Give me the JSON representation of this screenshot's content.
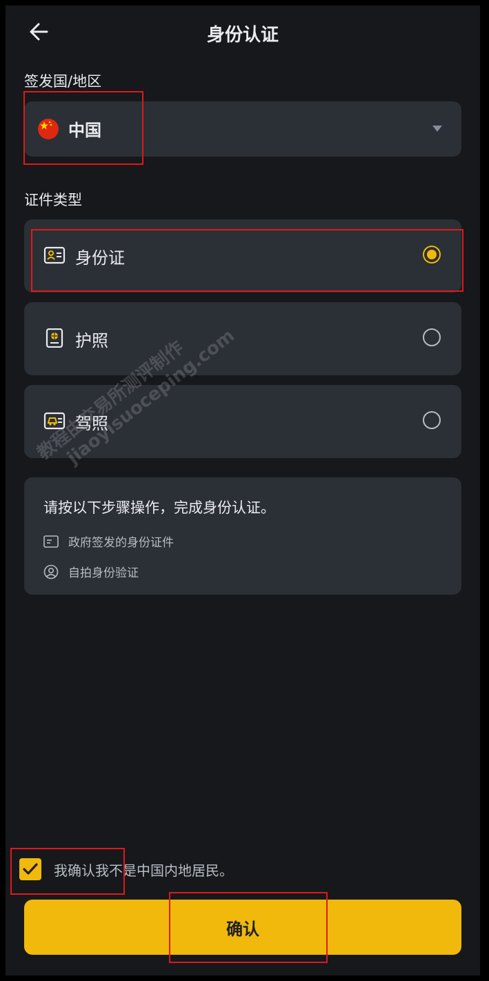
{
  "header": {
    "title": "身份认证",
    "back_icon": "arrow-left-icon"
  },
  "issuing_country": {
    "label": "签发国/地区",
    "selected": "中国",
    "flag_icon": "china-flag-icon"
  },
  "document_type": {
    "label": "证件类型",
    "options": [
      {
        "label": "身份证",
        "icon": "id-card-icon",
        "selected": true
      },
      {
        "label": "护照",
        "icon": "passport-icon",
        "selected": false
      },
      {
        "label": "驾照",
        "icon": "driver-license-icon",
        "selected": false
      }
    ]
  },
  "instructions": {
    "title": "请按以下步骤操作，完成身份认证。",
    "steps": [
      {
        "text": "政府签发的身份证件",
        "icon": "id-document-icon"
      },
      {
        "text": "自拍身份验证",
        "icon": "face-icon"
      }
    ]
  },
  "watermark": {
    "line1": "教程由交易所测评制作",
    "line2": "jiaoyisuoceping.com"
  },
  "declaration": {
    "text": "我确认我不是中国内地居民。",
    "checked": true
  },
  "confirm_button": {
    "label": "确认"
  },
  "colors": {
    "accent": "#f0b90b",
    "background": "#17181c",
    "card": "#2b2f36",
    "highlight": "#e0191b"
  }
}
